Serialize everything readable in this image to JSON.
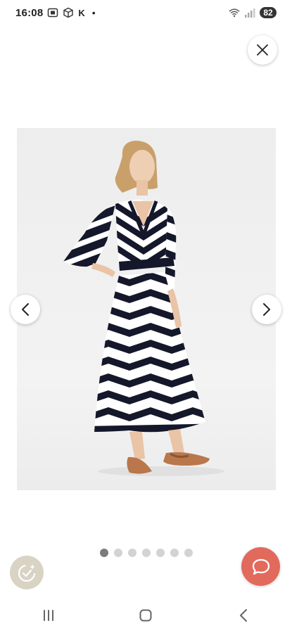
{
  "status_bar": {
    "time": "16:08",
    "carrier_letter": "K",
    "dot": "•",
    "battery": "82",
    "icons": [
      "screenshot-icon",
      "cube-icon",
      "wifi-icon",
      "signal-icon"
    ]
  },
  "gallery": {
    "image_subject": "model-in-striped-dress",
    "page_count": 7,
    "active_page": 1
  },
  "colors": {
    "chat_button": "#e16a5d",
    "badge_button": "#d9d3c4",
    "dot_active": "#7b7b7b",
    "dot_inactive": "#d3d3d3"
  },
  "icons": {
    "close": "close-icon",
    "prev": "chevron-left-icon",
    "next": "chevron-right-icon",
    "chat": "chat-bubble-icon",
    "badge": "sparkle-check-icon",
    "recents": "recents-icon",
    "home": "home-icon",
    "back": "back-icon"
  }
}
